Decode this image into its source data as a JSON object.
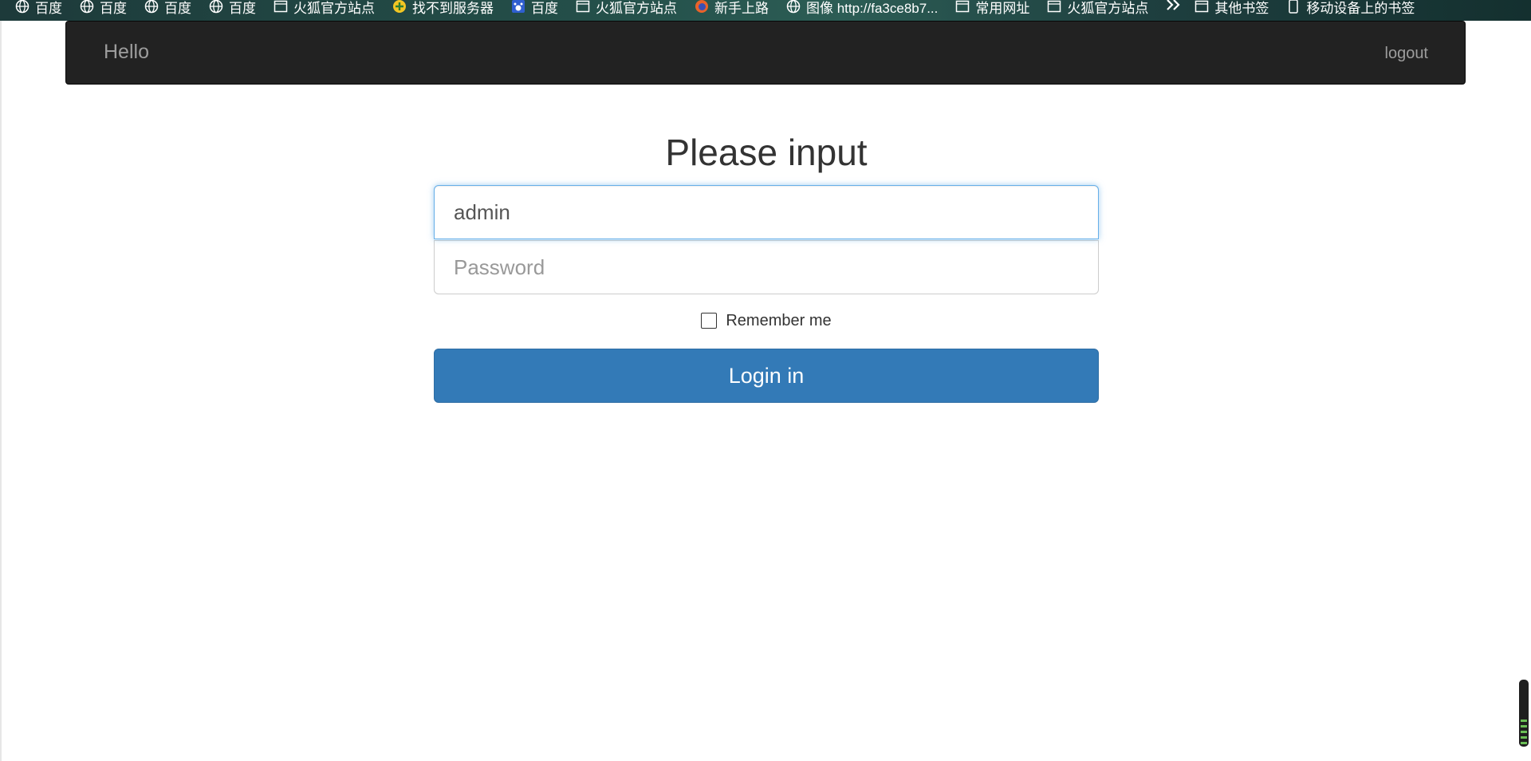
{
  "bookmarks": [
    {
      "label": "百度",
      "icon": "globe-icon"
    },
    {
      "label": "百度",
      "icon": "globe-icon"
    },
    {
      "label": "百度",
      "icon": "globe-icon"
    },
    {
      "label": "百度",
      "icon": "globe-icon"
    },
    {
      "label": "火狐官方站点",
      "icon": "folder-page-icon"
    },
    {
      "label": "找不到服务器",
      "icon": "plus-circle-icon"
    },
    {
      "label": "百度",
      "icon": "baidu-paw-icon"
    },
    {
      "label": "火狐官方站点",
      "icon": "folder-page-icon"
    },
    {
      "label": "新手上路",
      "icon": "firefox-icon"
    },
    {
      "label": "图像 http://fa3ce8b7...",
      "icon": "globe-icon"
    },
    {
      "label": "常用网址",
      "icon": "folder-page-icon"
    },
    {
      "label": "火狐官方站点",
      "icon": "folder-page-icon"
    }
  ],
  "bookmarks_overflow": {
    "icon": "double-chevron-right-icon"
  },
  "bookmarks_right": [
    {
      "label": "其他书签",
      "icon": "folder-page-icon"
    },
    {
      "label": "移动设备上的书签",
      "icon": "mobile-icon"
    }
  ],
  "navbar": {
    "brand": "Hello",
    "logout": "logout"
  },
  "form": {
    "heading": "Please input",
    "username_value": "admin",
    "password_placeholder": "Password",
    "remember_label": "Remember me",
    "remember_checked": false,
    "submit_label": "Login in"
  },
  "colors": {
    "navbar_bg": "#222222",
    "navbar_text": "#9d9d9d",
    "primary": "#337ab7",
    "focus": "#66afe9"
  }
}
